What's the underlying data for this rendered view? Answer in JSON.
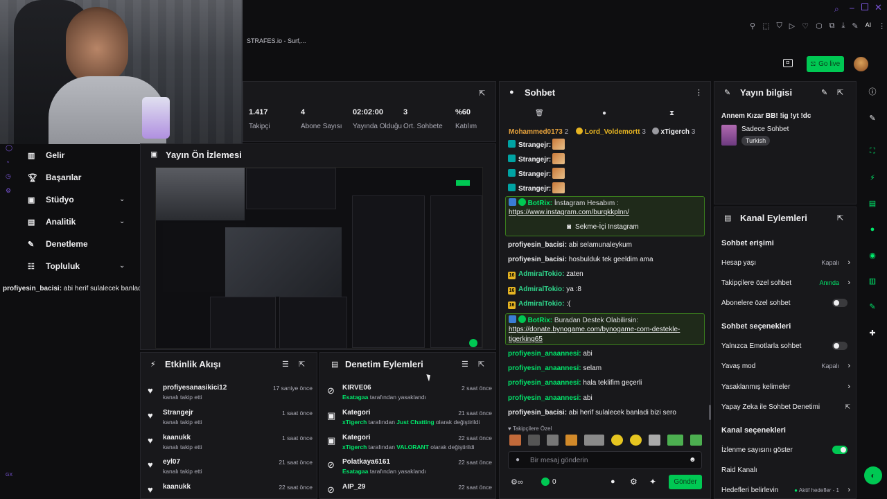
{
  "topbar": {
    "icons": [
      "search-icon",
      "minimize-icon",
      "restore-icon",
      "close-icon"
    ]
  },
  "browser_tab": {
    "title": "STRAFES.io - Surf,..."
  },
  "toolbar": {
    "ai_label": "AI"
  },
  "header": {
    "go_live_label": "Go live"
  },
  "stats": [
    {
      "value": "1.417",
      "label": "Takipçi"
    },
    {
      "value": "4",
      "label": "Abone Sayısı"
    },
    {
      "value": "02:02:00",
      "label": "Yayında Olduğu"
    },
    {
      "value": "3",
      "label": "Ort. Sohbete"
    },
    {
      "value": "%60",
      "label": "Katılım"
    }
  ],
  "nav": {
    "items": [
      {
        "label": "Gelir",
        "icon": "chart-icon",
        "chevron": false
      },
      {
        "label": "Başarılar",
        "icon": "trophy-icon",
        "chevron": false
      },
      {
        "label": "Stüdyo",
        "icon": "studio-icon",
        "chevron": true
      },
      {
        "label": "Analitik",
        "icon": "analytics-icon",
        "chevron": true
      },
      {
        "label": "Denetleme",
        "icon": "wrench-icon",
        "chevron": false
      },
      {
        "label": "Topluluk",
        "icon": "community-icon",
        "chevron": true
      }
    ],
    "overlay_message_user": "profiyesin_bacisi:",
    "overlay_message_text": " abi herif sulalecek banladi bizi sero",
    "footer_label": "GX"
  },
  "preview": {
    "title": "Yayın Ön İzlemesi"
  },
  "activity": {
    "title": "Etkinlik Akışı",
    "items": [
      {
        "name": "profiyesanasikici12",
        "sub": "kanalı takip etti",
        "time": "17 saniye önce"
      },
      {
        "name": "Strangejr",
        "sub": "kanalı takip etti",
        "time": "1 saat önce"
      },
      {
        "name": "kaanukk",
        "sub": "kanalı takip etti",
        "time": "1 saat önce"
      },
      {
        "name": "eyl07",
        "sub": "kanalı takip etti",
        "time": "21 saat önce"
      },
      {
        "name": "kaanukk",
        "sub": "",
        "time": "22 saat önce"
      }
    ]
  },
  "modactions": {
    "title": "Denetim Eylemleri",
    "items": [
      {
        "name": "KIRVE06",
        "actor": "Esatagaa",
        "mid": "",
        "highlight": "",
        "end": " tarafından yasaklandı",
        "time": "2 saat önce",
        "icon": "ban-icon"
      },
      {
        "name": "Kategori",
        "actor": "xTigerch",
        "mid": " tarafından ",
        "highlight": "Just Chatting",
        "end": " olarak değiştirildi",
        "time": "21 saat önce",
        "icon": "category-icon"
      },
      {
        "name": "Kategori",
        "actor": "xTigerch",
        "mid": " tarafından ",
        "highlight": "VALORANT",
        "end": " olarak değiştirildi",
        "time": "22 saat önce",
        "icon": "category-icon"
      },
      {
        "name": "Polatkaya6161",
        "actor": "Esatagaa",
        "mid": "",
        "highlight": "",
        "end": " tarafından yasaklandı",
        "time": "22 saat önce",
        "icon": "ban-icon"
      },
      {
        "name": "AIP_29",
        "actor": "",
        "mid": "",
        "highlight": "",
        "end": "",
        "time": "22 saat önce",
        "icon": "ban-icon"
      }
    ]
  },
  "chat": {
    "title": "Sohbet",
    "top_users": [
      {
        "name": "Mohammed0173",
        "count": "2",
        "color": "#e6a23c"
      },
      {
        "name": "Lord_Voldemortt",
        "count": "3",
        "color": "#e6b422"
      },
      {
        "name": "xTigerch",
        "count": "3",
        "color": "#efeff1"
      }
    ],
    "strange_user": "Strangejr:",
    "bot1": {
      "user": "BotRix:",
      "text": " İnstagram Hesabım :",
      "link": "https://www.instagram.com/burqkkplnn/",
      "button": "Sekme-İçi Instagram"
    },
    "lines1": [
      {
        "user": "profiyesin_bacisi:",
        "text": " abi selamunaleykum",
        "color": "#efeff1",
        "badge": false
      },
      {
        "user": "profiyesin_bacisi:",
        "text": " hosbulduk tek geeldim ama",
        "color": "#efeff1",
        "badge": false
      },
      {
        "user": "AdmiralTokio:",
        "text": " zaten",
        "color": "#2fd38a",
        "badge": true
      },
      {
        "user": "AdmiralTokio:",
        "text": " ya :8",
        "color": "#2fd38a",
        "badge": true
      },
      {
        "user": "AdmiralTokio:",
        "text": " :(",
        "color": "#2fd38a",
        "badge": true
      }
    ],
    "badge_text": "16",
    "bot2": {
      "user": "BotRix:",
      "text": " Buradan Destek Olabilirsin:",
      "link1": "https://donate.bynogame.com/bynogame-com-destekle-",
      "link2": "tigerking65"
    },
    "lines2": [
      {
        "user": "profiyesin_anaannesi:",
        "text": " abi"
      },
      {
        "user": "profiyesin_anaannesi:",
        "text": " selam"
      },
      {
        "user": "profiyesin_anaannesi:",
        "text": " hala teklifim geçerli"
      },
      {
        "user": "profiyesin_anaannesi:",
        "text": " abi"
      },
      {
        "user": "profiyesin_bacisi:",
        "text": " abi herif sulalecek banladi bizi sero"
      }
    ],
    "followers_only": "Takipçilere Özel",
    "input_placeholder": "Bir mesaj gönderin",
    "points": "0",
    "send_label": "Gönder"
  },
  "streaminfo": {
    "title": "Yayın bilgisi",
    "stream_title": "Annem Kızar BB! !ig !yt !dc",
    "category": "Sadece Sohbet",
    "tag": "Turkish"
  },
  "channel": {
    "title": "Kanal Eylemleri",
    "chat_access": "Sohbet erişimi",
    "account_age": {
      "label": "Hesap yaşı",
      "value": "Kapalı"
    },
    "followers_chat": {
      "label": "Takipçilere özel sohbet",
      "value": "Anında"
    },
    "subs_chat": {
      "label": "Abonelere özel sohbet"
    },
    "chat_options": "Sohbet seçenekleri",
    "emote_only": {
      "label": "Yalnızca Emotlarla sohbet"
    },
    "slow_mode": {
      "label": "Yavaş mod",
      "value": "Kapalı"
    },
    "banned_words": {
      "label": "Yasaklanmış kelimeler"
    },
    "ai_mod": {
      "label": "Yapay Zeka ile Sohbet Denetimi"
    },
    "channel_options": "Kanal seçenekleri",
    "show_views": {
      "label": "İzlenme sayısını göster"
    },
    "raid": {
      "label": "Raid Kanalı"
    },
    "goals": {
      "label": "Hedefleri belirlevin",
      "value": "Aktif hedefler - 1"
    }
  },
  "colors": {
    "accent": "#00e86b",
    "panel": "#18181b",
    "bg": "#0e0e10",
    "link": "#efeff1"
  }
}
